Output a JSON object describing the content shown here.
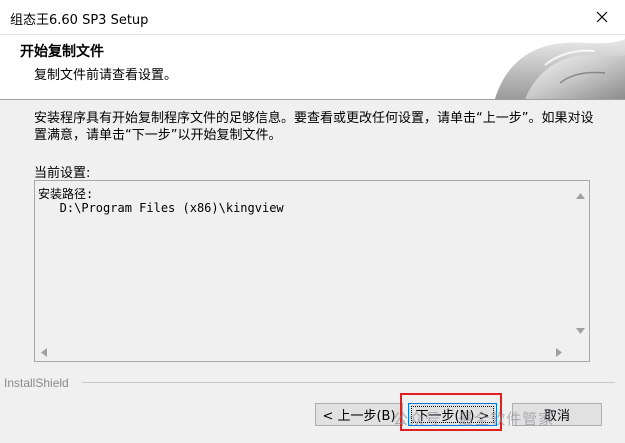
{
  "window": {
    "title": "组态王6.60 SP3 Setup"
  },
  "header": {
    "title": "开始复制文件",
    "subtitle": "复制文件前请查看设置。"
  },
  "body": {
    "instructions": "安装程序具有开始复制程序文件的足够信息。要查看或更改任何设置，请单击“上一步”。如果对设置满意，请单击“下一步”以开始复制文件。",
    "current_settings_label": "当前设置:",
    "settings_text": "安装路径:\n   D:\\Program Files (x86)\\kingview"
  },
  "footer": {
    "brand": "InstallShield",
    "back_label": "< 上一步(B)",
    "next_label": "下一步(N) >",
    "cancel_label": "取消"
  },
  "watermark": "公众号 · 最全软件管家",
  "colors": {
    "highlight": "#e02020",
    "focus_border": "#0078d7"
  }
}
